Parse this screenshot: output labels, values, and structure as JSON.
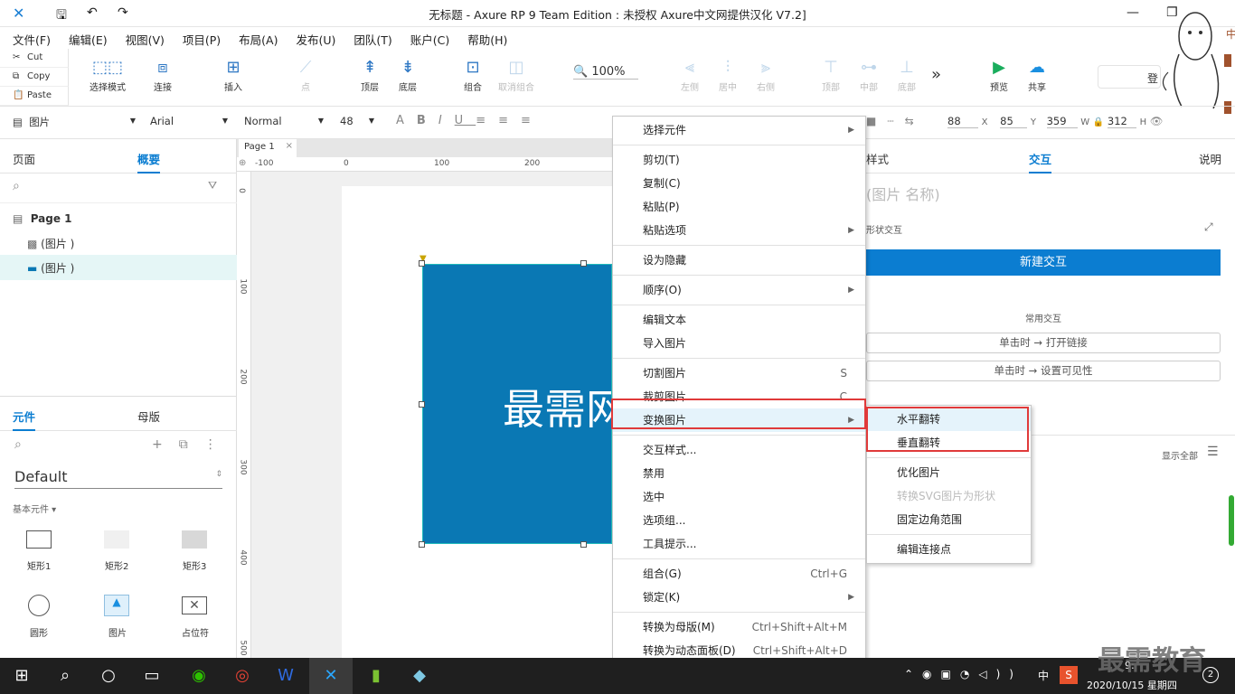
{
  "window": {
    "title": "无标题 - Axure RP 9 Team Edition : 未授权    Axure中文网提供汉化 V7.2]"
  },
  "menubar": [
    "文件(F)",
    "编辑(E)",
    "视图(V)",
    "项目(P)",
    "布局(A)",
    "发布(U)",
    "团队(T)",
    "账户(C)",
    "帮助(H)"
  ],
  "clipboard": {
    "cut": "Cut",
    "copy": "Copy",
    "paste": "Paste"
  },
  "toolbar": {
    "select_mode": "选择模式",
    "connect": "连接",
    "insert": "插入",
    "point": "点",
    "top_layer": "顶层",
    "bottom_layer": "底层",
    "group": "组合",
    "ungroup": "取消组合",
    "zoom": "100%",
    "align_left": "左侧",
    "align_center": "居中",
    "align_right": "右侧",
    "align_top": "顶部",
    "align_middle": "中部",
    "align_bottom": "底部",
    "more": "»",
    "preview": "预览",
    "share": "共享",
    "login": "登"
  },
  "format": {
    "widget_type": "图片",
    "font": "Arial",
    "weight": "Normal",
    "size": "48",
    "x_label": "X",
    "x": "88",
    "y_label": "Y",
    "y": "85",
    "w_label": "W",
    "w": "359",
    "h_label": "H",
    "h": "312"
  },
  "left": {
    "tab_pages": "页面",
    "tab_outline": "概要",
    "page_name": "Page 1",
    "items": [
      "(图片 )",
      "(图片 )"
    ],
    "tab_widgets": "元件",
    "tab_masters": "母版",
    "library": "Default",
    "category": "基本元件 ▾",
    "widgets": [
      "矩形1",
      "矩形2",
      "矩形3",
      "圆形",
      "图片",
      "占位符"
    ]
  },
  "canvas": {
    "tab": "Page 1",
    "ruler_h": [
      "-100",
      "0",
      "100",
      "200"
    ],
    "ruler_v": [
      "0",
      "100",
      "200",
      "300",
      "400",
      "500"
    ],
    "image_text": "最需网"
  },
  "right": {
    "tab_style": "样式",
    "tab_interact": "交互",
    "tab_notes": "说明",
    "name_placeholder": "(图片 名称)",
    "shape_interact": "形状交互",
    "new_interaction": "新建交互",
    "common": "常用交互",
    "common1": "单击时 → 打开链接",
    "common2": "单击时 → 设置可见性",
    "show_all": "显示全部"
  },
  "context_menu": [
    {
      "label": "选择元件",
      "sub": true
    },
    {
      "sep": true
    },
    {
      "label": "剪切(T)"
    },
    {
      "label": "复制(C)"
    },
    {
      "label": "粘贴(P)"
    },
    {
      "label": "粘贴选项",
      "sub": true
    },
    {
      "sep": true
    },
    {
      "label": "设为隐藏"
    },
    {
      "sep": true
    },
    {
      "label": "顺序(O)",
      "sub": true
    },
    {
      "sep": true
    },
    {
      "label": "编辑文本"
    },
    {
      "label": "导入图片"
    },
    {
      "sep": true
    },
    {
      "label": "切割图片",
      "shortcut": "S"
    },
    {
      "label": "裁剪图片",
      "shortcut": "C"
    },
    {
      "label": "变换图片",
      "sub": true,
      "highlight": true
    },
    {
      "sep": true
    },
    {
      "label": "交互样式..."
    },
    {
      "label": "禁用"
    },
    {
      "label": "选中"
    },
    {
      "label": "选项组..."
    },
    {
      "label": "工具提示..."
    },
    {
      "sep": true
    },
    {
      "label": "组合(G)",
      "shortcut": "Ctrl+G"
    },
    {
      "label": "锁定(K)",
      "sub": true
    },
    {
      "sep": true
    },
    {
      "label": "转换为母版(M)",
      "shortcut": "Ctrl+Shift+Alt+M"
    },
    {
      "label": "转换为动态面板(D)",
      "shortcut": "Ctrl+Shift+Alt+D"
    }
  ],
  "submenu": [
    {
      "label": "水平翻转",
      "highlight": true
    },
    {
      "label": "垂直翻转"
    },
    {
      "sep": true
    },
    {
      "label": "优化图片"
    },
    {
      "label": "转换SVG图片为形状",
      "disabled": true
    },
    {
      "label": "固定边角范围"
    },
    {
      "sep": true
    },
    {
      "label": "编辑连接点"
    }
  ],
  "taskbar": {
    "ime": "中",
    "time": "9:",
    "date": "2020/10/15 星期四",
    "badge": "2"
  },
  "watermark": "最需教育",
  "colors": {
    "accent": "#0b7dd1",
    "image_fill": "#0a78b4",
    "highlight_box": "#e03a3a",
    "taskbar": "#1f1f1f"
  }
}
